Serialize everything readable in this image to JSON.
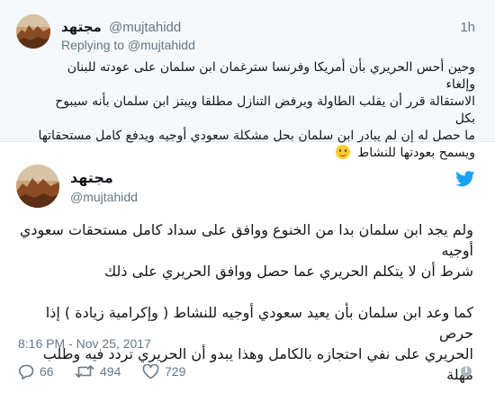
{
  "parent_tweet": {
    "display_name": "مجتهد",
    "handle": "@mujtahidd",
    "timestamp": "1h",
    "reply_prefix": "Replying to",
    "reply_to": "@mujtahidd",
    "text_lines": [
      "وحين أحس الحريري بأن أمريكا وفرنسا سترغمان ابن سلمان على عودته للبنان وإلغاء",
      "الاستقالة قرر أن يقلب الطاولة ويرفض التنازل مطلقا ويبتز ابن سلمان بأنه سيبوح بكل",
      "ما حصل له إن لم يبادر ابن سلمان بحل مشكلة سعودي أوجيه ويدفع كامل مستحقاتها",
      "ويسمح بعودتها للنشاط"
    ],
    "emoji": "slightly-smiling-face"
  },
  "main_tweet": {
    "display_name": "مجتهد",
    "handle": "@mujtahidd",
    "paragraph_1": [
      "ولم يجد ابن سلمان بدا من الخنوع ووافق على سداد كامل مستحقات سعودي أوجيه",
      "شرط أن لا يتكلم الحريري عما حصل ووافق الحريري على ذلك"
    ],
    "paragraph_2": [
      "كما وعد ابن سلمان بأن يعيد سعودي أوجيه للنشاط ( وإكرامية زيادة ) إذا حرص",
      "الحريري على نفي احتجازه بالكامل وهذا يبدو أن الحريري تردد فيه وطلب مهلة"
    ],
    "timestamp": "8:16 PM - Nov 25, 2017",
    "reply_count": "66",
    "retweet_count": "494",
    "like_count": "729"
  },
  "colors": {
    "twitter_blue": "#1da1f2",
    "secondary_text": "#657786",
    "parent_background": "#f5f8fa"
  },
  "icons": {
    "brand": "twitter-bird-icon",
    "reply": "reply-icon",
    "retweet": "retweet-icon",
    "like": "heart-icon",
    "info": "info-icon"
  }
}
